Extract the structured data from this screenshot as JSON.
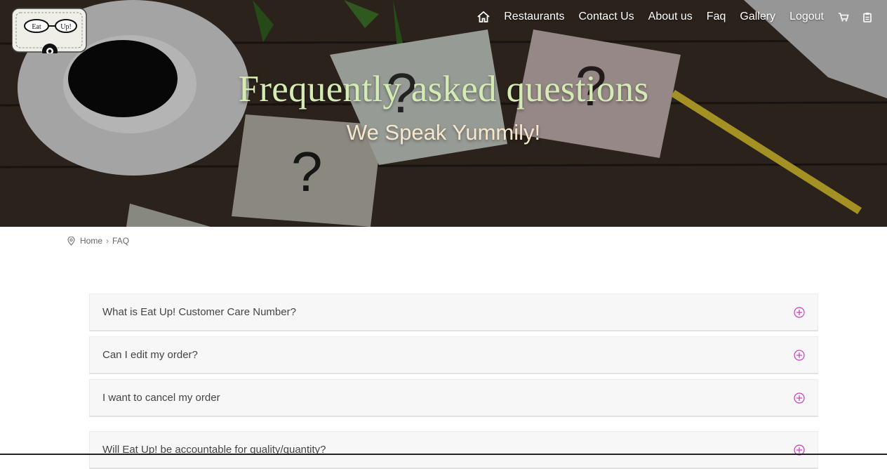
{
  "brand": {
    "logo_words": [
      "Eat",
      "Up!"
    ]
  },
  "nav": {
    "home_icon": "home-icon",
    "items": [
      {
        "label": "Restaurants"
      },
      {
        "label": "Contact Us"
      },
      {
        "label": "About us"
      },
      {
        "label": "Faq"
      },
      {
        "label": "Gallery"
      },
      {
        "label": "Logout"
      }
    ],
    "cart_icon": "cart-icon",
    "clipboard_icon": "clipboard-icon"
  },
  "hero": {
    "title": "Frequently asked questions",
    "subtitle": "We Speak Yummily!"
  },
  "breadcrumb": {
    "icon": "location-pin-icon",
    "home": "Home",
    "separator": "›",
    "current": "FAQ"
  },
  "faq": {
    "toggle_icon": "plus-circle-icon",
    "accent_color": "#c83fbf",
    "items": [
      {
        "question": "What is Eat Up! Customer Care Number?"
      },
      {
        "question": "Can I edit my order?"
      },
      {
        "question": "I want to cancel my order"
      },
      {
        "question": "Will Eat Up! be accountable for quality/quantity?"
      }
    ]
  }
}
